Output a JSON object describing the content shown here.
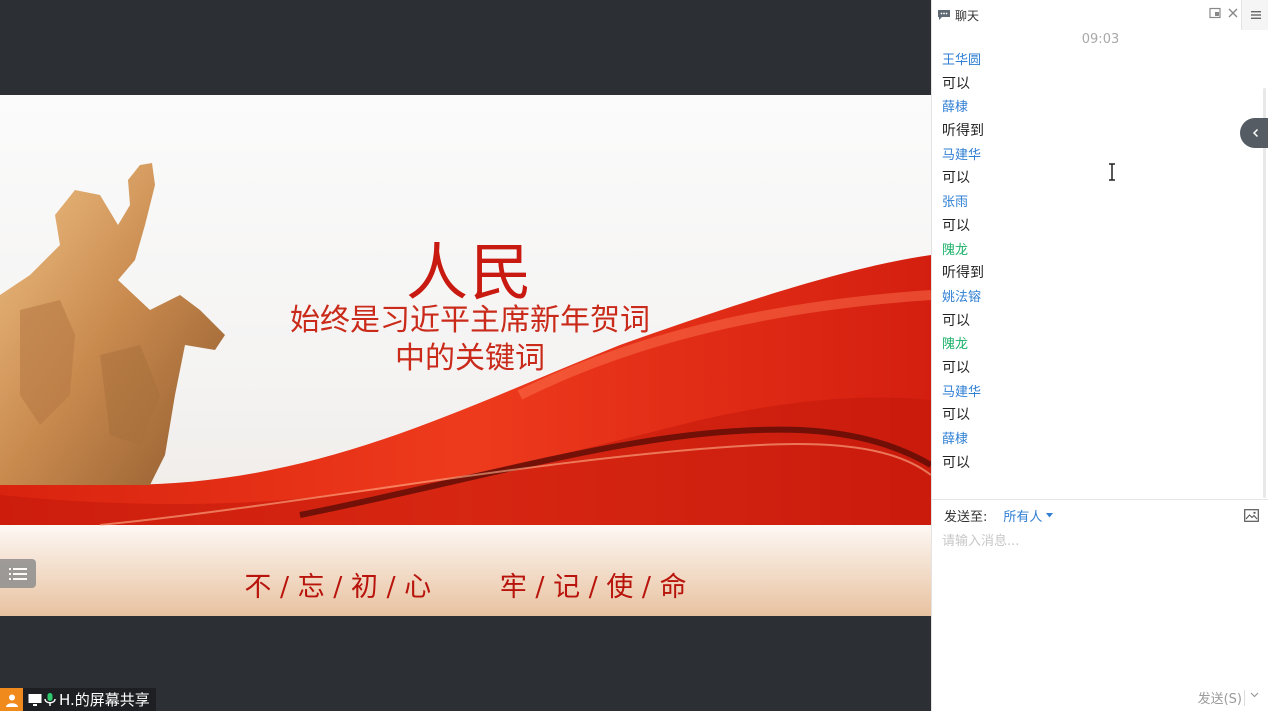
{
  "slide": {
    "title": "人民",
    "subtitle_line1": "始终是习近平主席新年贺词",
    "subtitle_line2": "中的关键词",
    "slogan": "不 / 忘 / 初 / 心        牢 / 记 / 使 / 命"
  },
  "share_label": "H.的屏幕共享",
  "chat": {
    "title": "聊天",
    "time": "09:03",
    "messages": [
      {
        "sender": "王华圆",
        "text": "可以"
      },
      {
        "sender": "薛棣",
        "text": "听得到"
      },
      {
        "sender": "马建华",
        "text": "可以"
      },
      {
        "sender": "张雨",
        "text": "可以"
      },
      {
        "sender": "隗龙",
        "text": "听得到"
      },
      {
        "sender": "姚法镕",
        "text": "可以"
      },
      {
        "sender": "隗龙",
        "text": "可以"
      },
      {
        "sender": "马建华",
        "text": "可以"
      },
      {
        "sender": "薛棣",
        "text": "可以"
      }
    ],
    "send_to_label": "发送至:",
    "send_to_target": "所有人",
    "input_placeholder": "请输入消息...",
    "send_button": "发送(S)"
  },
  "colors": {
    "sender_blue": "#2f7fd3",
    "sender_green": "#1db26a",
    "slide_red": "#c81a10",
    "share_badge": "#f08a1c"
  },
  "icons": {
    "chat": "speech-bubble-icon",
    "popout": "popout-icon",
    "close": "close-icon",
    "menu": "hamburger-icon",
    "collapse": "chevron-left-icon",
    "image": "image-icon",
    "dropdown": "caret-down-icon"
  }
}
